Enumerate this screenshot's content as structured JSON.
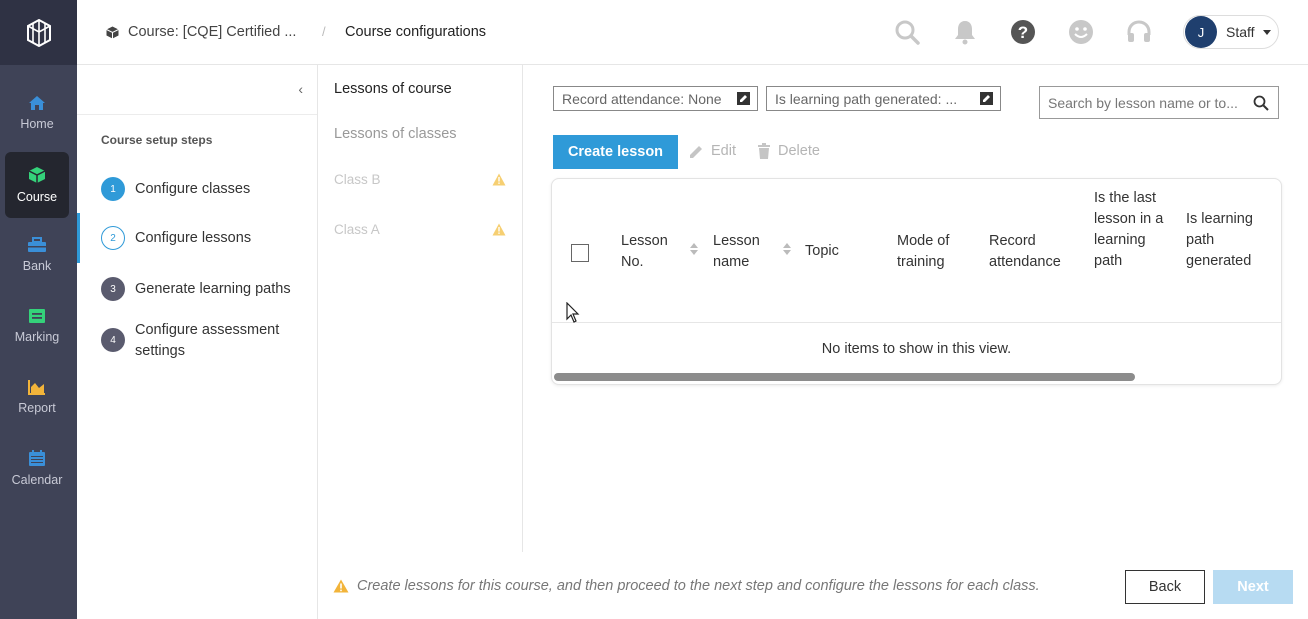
{
  "rail": {
    "items": [
      {
        "label": "Home",
        "icon": "home-icon",
        "color": "#3a8fd8"
      },
      {
        "label": "Course",
        "icon": "course-cube-icon",
        "color": "#34d27a"
      },
      {
        "label": "Bank",
        "icon": "bank-icon",
        "color": "#3a8fd8"
      },
      {
        "label": "Marking",
        "icon": "marking-icon",
        "color": "#34d27a"
      },
      {
        "label": "Report",
        "icon": "report-icon",
        "color": "#f2b43a"
      },
      {
        "label": "Calendar",
        "icon": "calendar-icon",
        "color": "#3a8fd8"
      }
    ]
  },
  "header": {
    "breadcrumb_course": "Course: [CQE] Certified ...",
    "breadcrumb_sep": "/",
    "breadcrumb_current": "Course configurations",
    "user_initial": "J",
    "user_label": "Staff"
  },
  "steps": {
    "title": "Course setup steps",
    "items": [
      {
        "num": "1",
        "label": "Configure classes"
      },
      {
        "num": "2",
        "label": "Configure lessons"
      },
      {
        "num": "3",
        "label": "Generate learning paths"
      },
      {
        "num": "4",
        "label": "Configure assessment settings"
      }
    ]
  },
  "lessons_nav": {
    "items": [
      "Lessons of course",
      "Lessons of classes",
      "Class B",
      "Class A"
    ]
  },
  "filters": {
    "record_attendance": "Record attendance: None",
    "learning_path": "Is learning path generated: ...",
    "search_placeholder": "Search by lesson name or to..."
  },
  "toolbar": {
    "create": "Create lesson",
    "edit": "Edit",
    "delete": "Delete"
  },
  "table": {
    "columns": [
      "Lesson No.",
      "Lesson name",
      "Topic",
      "Mode of training",
      "Record attendance",
      "Is the last lesson in a learning path",
      "Is learning path generated"
    ],
    "empty_text": "No items to show in this view."
  },
  "footer": {
    "message": "Create lessons for this course, and then proceed to the next step and configure the lessons for each class.",
    "back": "Back",
    "next": "Next"
  },
  "colors": {
    "accent": "#2f9ad8",
    "rail_bg": "#3f4357",
    "warning": "#f2b43a",
    "next_disabled": "#b7dbf2"
  }
}
